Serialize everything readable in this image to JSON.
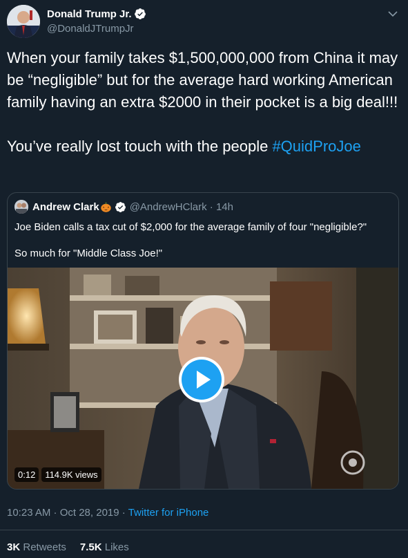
{
  "author": {
    "name": "Donald Trump Jr.",
    "handle": "@DonaldJTrumpJr"
  },
  "tweet": {
    "paragraph1": "When your family takes $1,500,000,000 from China it may be “negligible” but for the average hard working American family having an extra $2000 in their pocket is a big deal!!!",
    "paragraph2_prefix": "You’ve really lost touch with the people ",
    "hashtag": "#QuidProJoe"
  },
  "quoted": {
    "name": "Andrew Clark",
    "emoji": "pumpkin-emoji",
    "handle_time": "@AndrewHClark · 14h",
    "line1": "Joe Biden calls a tax cut of $2,000 for the average family of four \"negligible?\"",
    "line2": "So much for \"Middle Class Joe!\"",
    "video": {
      "duration": "0:12",
      "views": "114.9K views"
    }
  },
  "meta": {
    "timestamp": "10:23 AM · Oct 28, 2019 · ",
    "source": "Twitter for iPhone"
  },
  "stats": {
    "retweets_count": "3K",
    "retweets_label": " Retweets",
    "likes_count": "7.5K",
    "likes_label": " Likes"
  },
  "colors": {
    "background": "#15202b",
    "accent": "#1da1f2",
    "secondary_text": "#8899a6",
    "border": "#38444d"
  }
}
